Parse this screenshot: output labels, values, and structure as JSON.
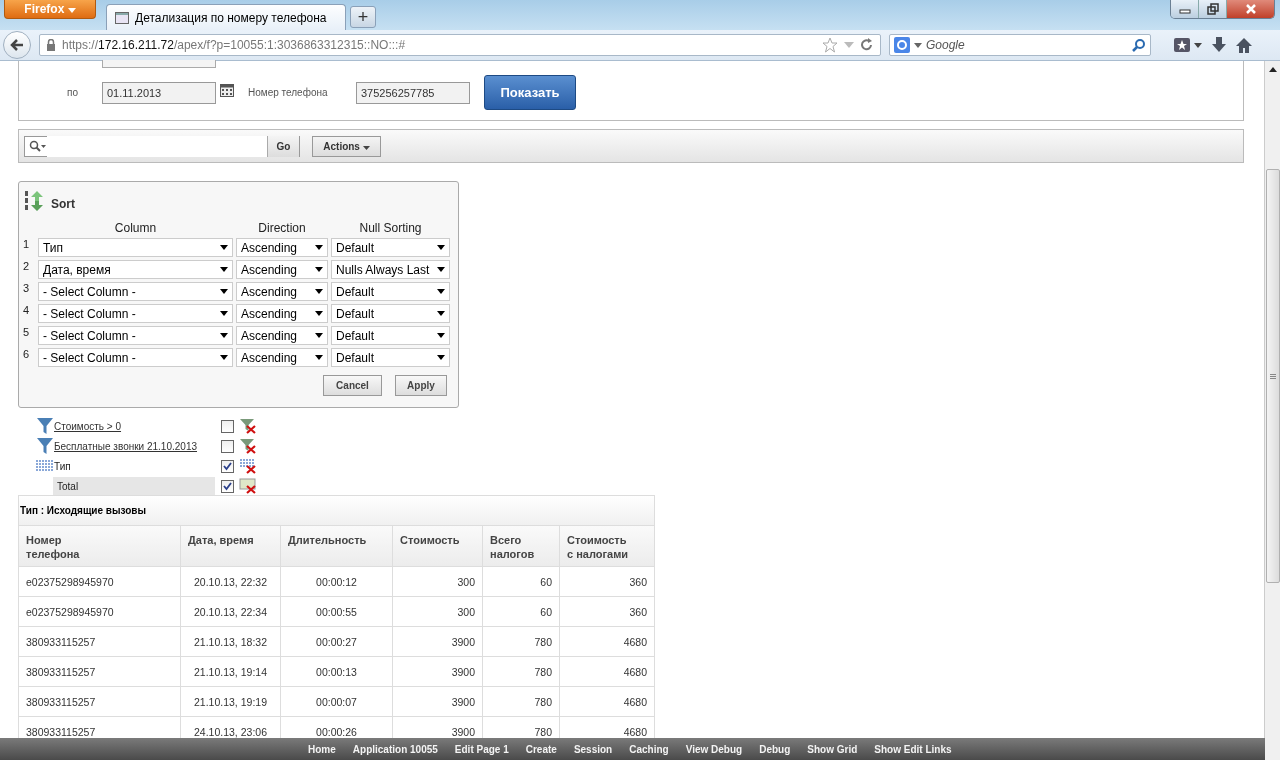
{
  "browser": {
    "menu_button": "Firefox",
    "tab_title": "Детализация по номеру телефона",
    "new_tab": "+",
    "url": {
      "scheme": "https://",
      "host": "172.16.211.72",
      "path": "/apex/f?p=10055:1:3036863312315::NO:::#"
    },
    "search_placeholder": "Google"
  },
  "form": {
    "to_label": "по",
    "to_value": "01.11.2013",
    "phone_label": "Номер телефона",
    "phone_value": "375256257785",
    "submit": "Показать"
  },
  "toolbar": {
    "go": "Go",
    "actions": "Actions"
  },
  "sort": {
    "title": "Sort",
    "headers": [
      "Column",
      "Direction",
      "Null Sorting"
    ],
    "rows": [
      {
        "number": "1",
        "column": "Тип",
        "direction": "Ascending",
        "nulls": "Default"
      },
      {
        "number": "2",
        "column": "Дата, время",
        "direction": "Ascending",
        "nulls": "Nulls Always Last"
      },
      {
        "number": "3",
        "column": "- Select Column -",
        "direction": "Ascending",
        "nulls": "Default"
      },
      {
        "number": "4",
        "column": "- Select Column -",
        "direction": "Ascending",
        "nulls": "Default"
      },
      {
        "number": "5",
        "column": "- Select Column -",
        "direction": "Ascending",
        "nulls": "Default"
      },
      {
        "number": "6",
        "column": "- Select Column -",
        "direction": "Ascending",
        "nulls": "Default"
      }
    ],
    "buttons": [
      "Cancel",
      "Apply"
    ]
  },
  "filters": [
    {
      "kind": "filter",
      "label": "Стоимость > 0",
      "enabled": false
    },
    {
      "kind": "filter",
      "label": "Бесплатные звонки 21.10.2013",
      "enabled": false
    },
    {
      "kind": "control_break",
      "label": "Тип",
      "enabled": true
    },
    {
      "kind": "aggregate",
      "label": "Total",
      "enabled": true
    }
  ],
  "report": {
    "break_label": "Тип : Исходящие вызовы",
    "columns": [
      "Номер\nтелефона",
      "Дата, время",
      "Длительность",
      "Стоимость",
      "Всего\nналогов",
      "Стоимость\nс налогами"
    ],
    "rows": [
      [
        "e02375298945970",
        "20.10.13, 22:32",
        "00:00:12",
        "300",
        "60",
        "360"
      ],
      [
        "e02375298945970",
        "20.10.13, 22:34",
        "00:00:55",
        "300",
        "60",
        "360"
      ],
      [
        "380933115257",
        "21.10.13, 18:32",
        "00:00:27",
        "3900",
        "780",
        "4680"
      ],
      [
        "380933115257",
        "21.10.13, 19:14",
        "00:00:13",
        "3900",
        "780",
        "4680"
      ],
      [
        "380933115257",
        "21.10.13, 19:19",
        "00:00:07",
        "3900",
        "780",
        "4680"
      ],
      [
        "380933115257",
        "24.10.13, 23:06",
        "00:00:26",
        "3900",
        "780",
        "4680"
      ]
    ]
  },
  "dev_bar": [
    "Home",
    "Application 10055",
    "Edit Page 1",
    "Create",
    "Session",
    "Caching",
    "View Debug",
    "Debug",
    "Show Grid",
    "Show Edit Links"
  ]
}
